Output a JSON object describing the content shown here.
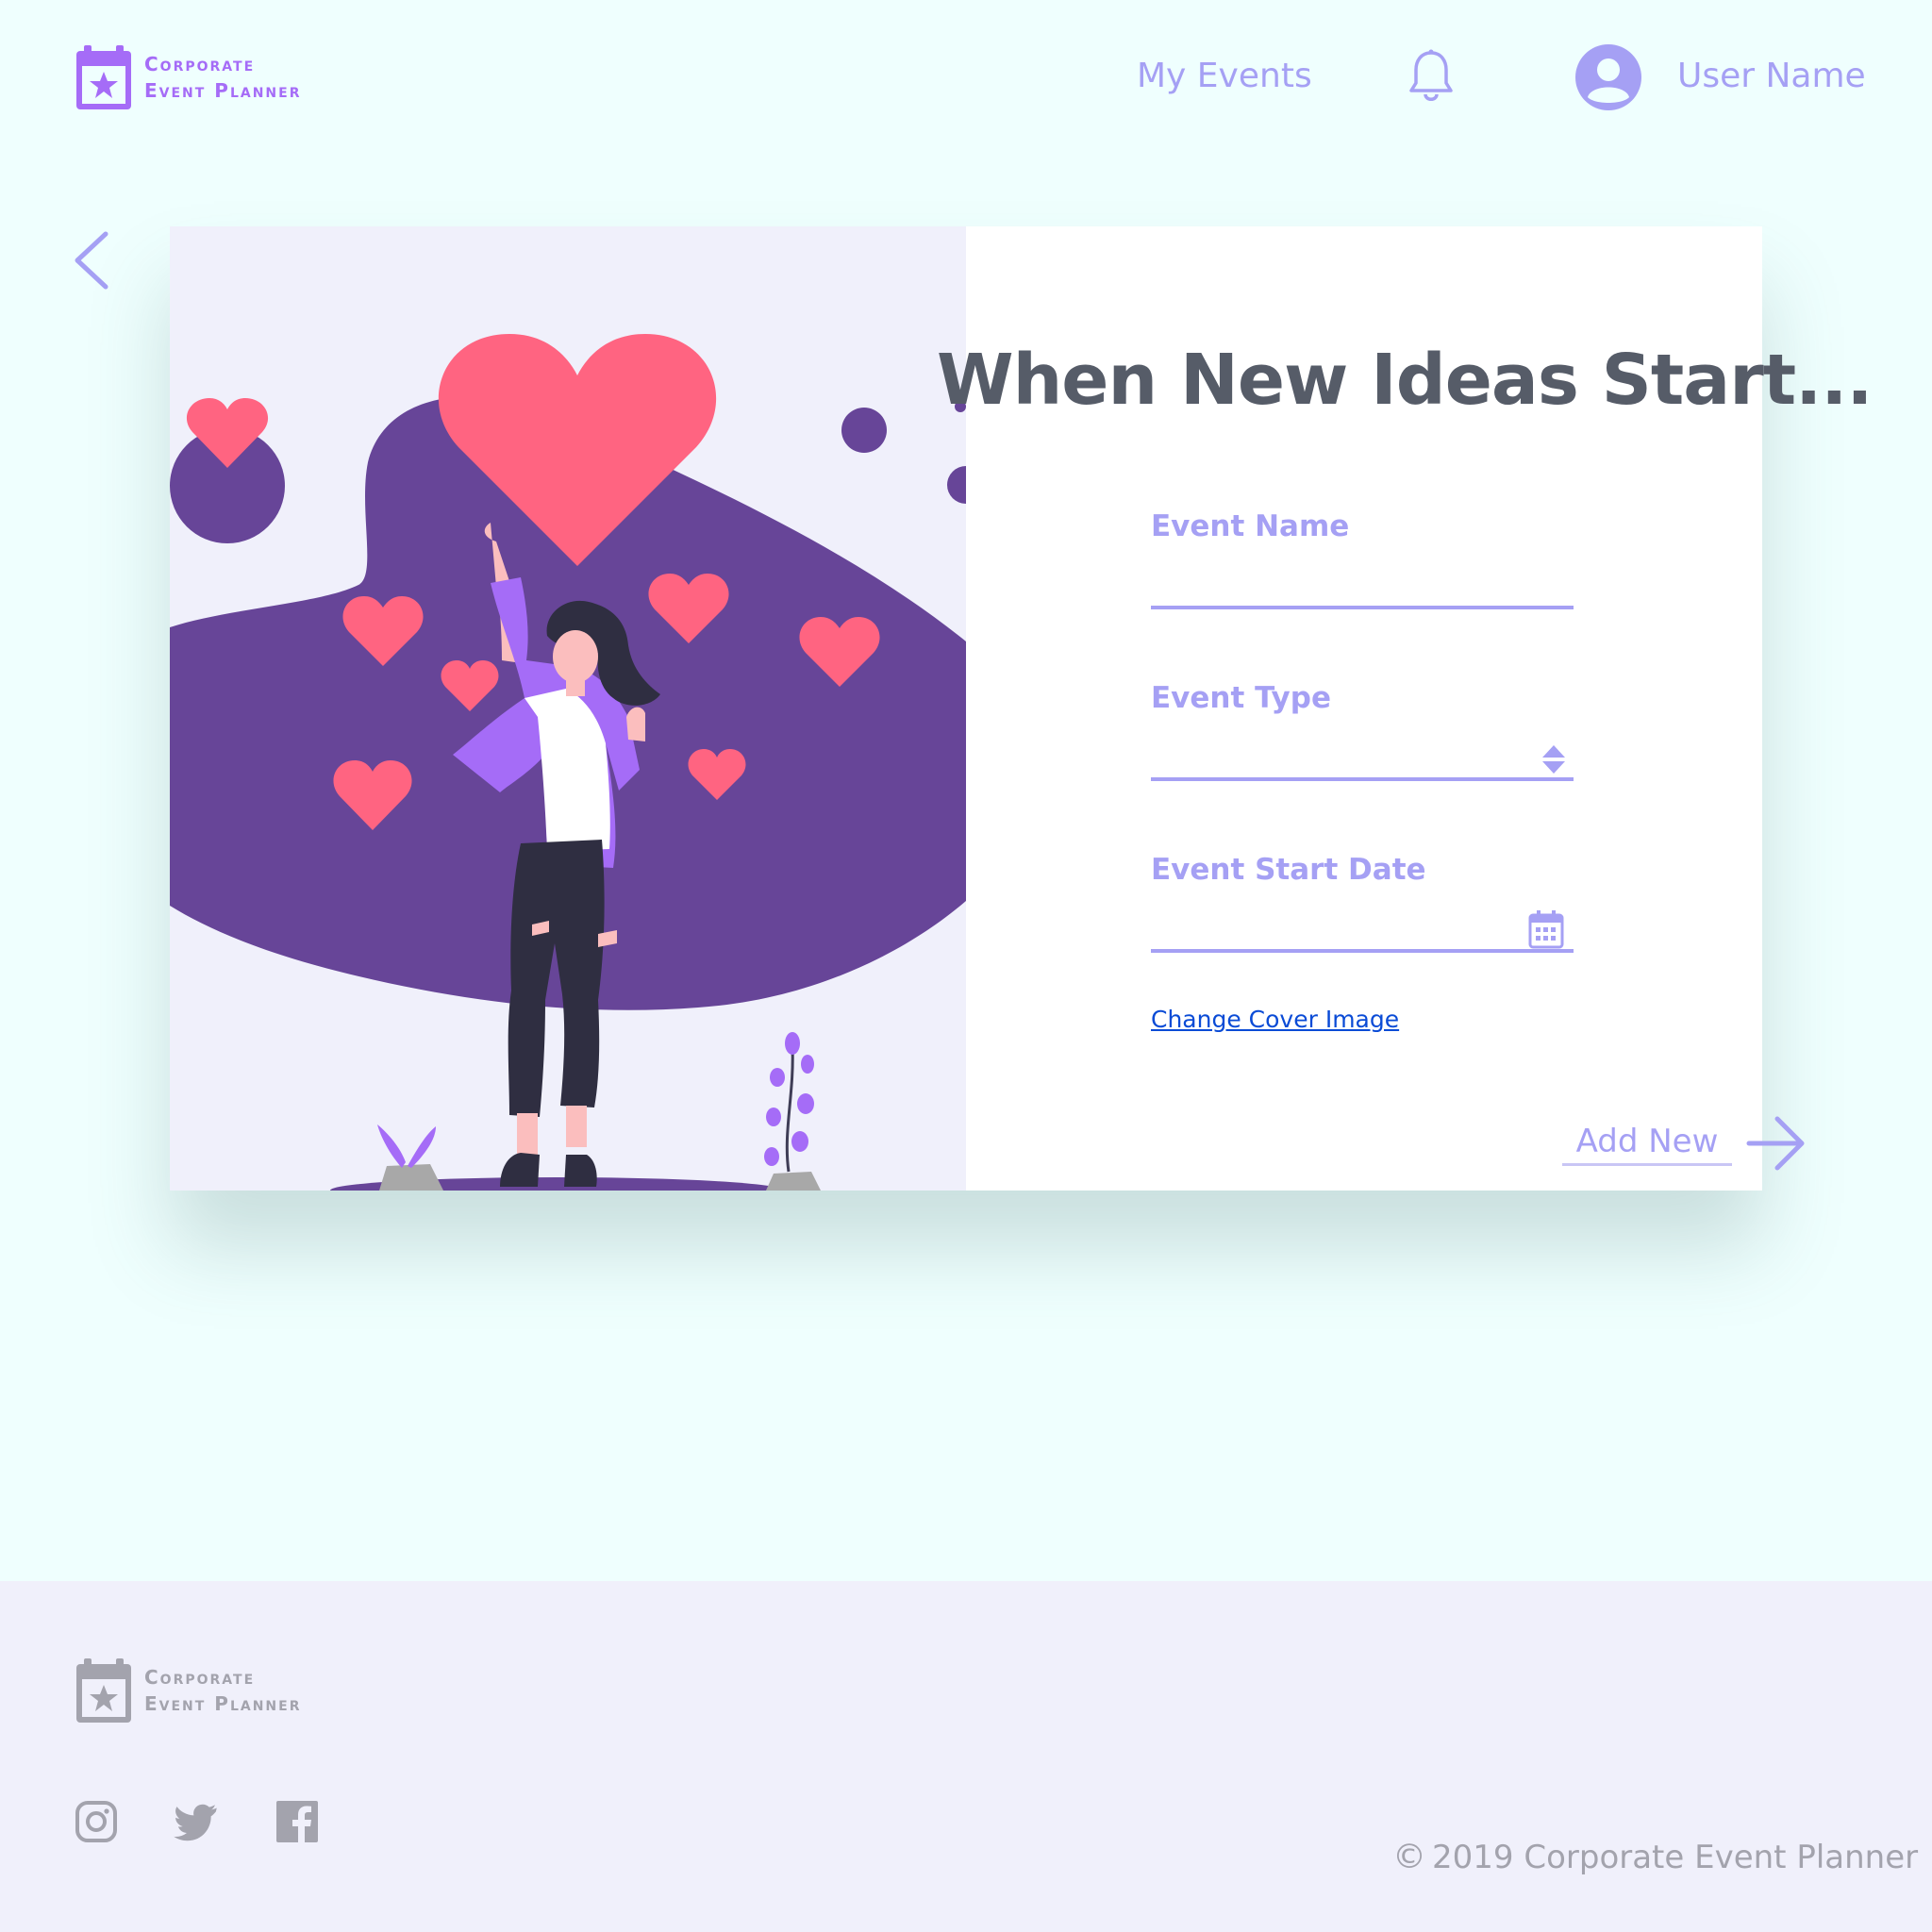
{
  "brand": {
    "line1": "Corporate",
    "line2": "Event Planner"
  },
  "header": {
    "nav_my_events": "My Events",
    "user_name": "User Name"
  },
  "main": {
    "headline": "When New Ideas Start...",
    "fields": [
      {
        "label": "Event Name",
        "value": "",
        "placeholder": ""
      },
      {
        "label": "Event Type",
        "value": "",
        "placeholder": ""
      },
      {
        "label": "Event Start Date",
        "value": "",
        "placeholder": ""
      }
    ],
    "change_cover_label": "Change Cover Image",
    "add_new_label": "Add New"
  },
  "footer": {
    "copyright_symbol": "©",
    "copyright_text": "2019 Corporate Event Planner"
  },
  "colors": {
    "background": "#effffe",
    "accent": "#a5a0f4",
    "brand_purple": "#a56cf7",
    "blob_purple": "#674598",
    "heart_pink": "#ff6481",
    "heading": "#565c68",
    "footer_bg": "#f0f0fb",
    "footer_text": "#a3a3ad",
    "link_blue": "#0a4bd6"
  },
  "icons": {
    "logo": "calendar-star-icon",
    "notifications": "bell-icon",
    "user": "user-avatar-icon",
    "back": "chevron-left-icon",
    "next": "arrow-right-icon",
    "event_type": "up-down-stepper-icon",
    "date": "calendar-icon",
    "social": [
      "instagram-icon",
      "twitter-icon",
      "facebook-icon"
    ]
  }
}
